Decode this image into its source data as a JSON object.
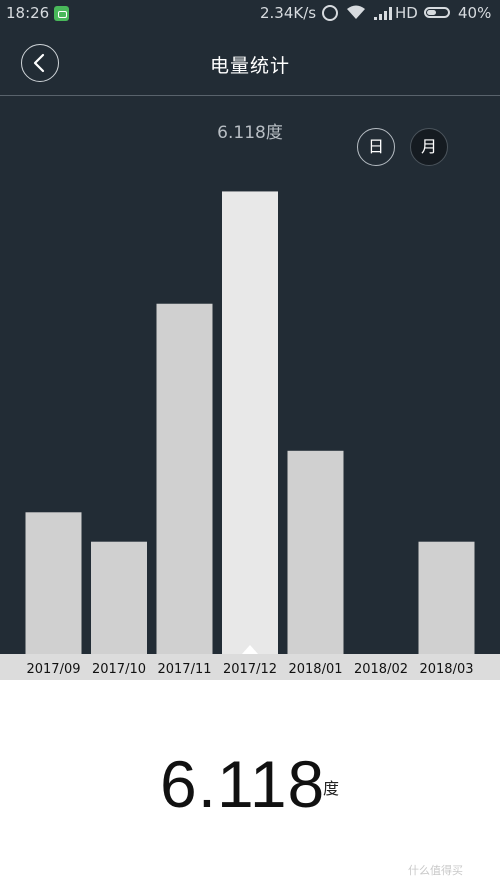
{
  "status_bar": {
    "time": "18:26",
    "net_speed": "2.34K/s",
    "network": "HD",
    "battery": "40%",
    "icons": [
      "app-notification-icon",
      "alarm-icon",
      "wifi-icon",
      "signal-icon",
      "battery-icon"
    ]
  },
  "header": {
    "title": "电量统计",
    "back_icon": "chevron-left-icon"
  },
  "period_toggle": {
    "day_label": "日",
    "month_label": "月",
    "selected": "月"
  },
  "selected_value_label": "6.118度",
  "summary": {
    "value": "6.118",
    "unit": "度"
  },
  "watermark": "什么值得买",
  "colors": {
    "background": "#222c35",
    "bar": "#d0d0d0",
    "bar_selected": "#e8e8e8",
    "bottom_bg": "#ffffff"
  },
  "chart_data": {
    "type": "bar",
    "categories": [
      "2017/09",
      "2017/10",
      "2017/11",
      "2017/12",
      "2018/01",
      "2018/02",
      "2018/03"
    ],
    "values": [
      5.3,
      4.2,
      13.1,
      17.3,
      7.6,
      0,
      4.2
    ],
    "selected_index": 3,
    "ylim": [
      0,
      18.7
    ],
    "title": "",
    "xlabel": "",
    "ylabel": "",
    "grid": false
  }
}
